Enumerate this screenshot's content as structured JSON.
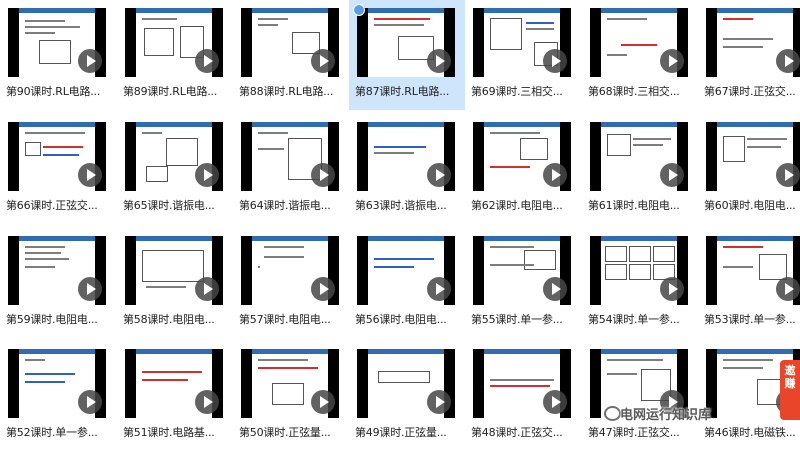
{
  "colors": {
    "thumb_bg": "#000000",
    "selected_bg": "#cfe5fb",
    "slide_header": "#2e6db0",
    "badge": "#e8452b"
  },
  "tiles": [
    {
      "caption": "第90课时.RL电路..."
    },
    {
      "caption": "第89课时.RL电路..."
    },
    {
      "caption": "第88课时.RL电路..."
    },
    {
      "caption": "第87课时.RL电路...",
      "selected": true
    },
    {
      "caption": "第69课时.三相交..."
    },
    {
      "caption": "第68课时.三相交..."
    },
    {
      "caption": "第67课时.正弦交..."
    },
    {
      "caption": "第66课时.正弦交..."
    },
    {
      "caption": "第65课时.谐振电..."
    },
    {
      "caption": "第64课时.谐振电..."
    },
    {
      "caption": "第63课时.谐振电..."
    },
    {
      "caption": "第62课时.电阻电..."
    },
    {
      "caption": "第61课时.电阻电..."
    },
    {
      "caption": "第60课时.电阻电..."
    },
    {
      "caption": "第59课时.电阻电..."
    },
    {
      "caption": "第58课时.电阻电..."
    },
    {
      "caption": "第57课时.电阻电..."
    },
    {
      "caption": "第56课时.电阻电..."
    },
    {
      "caption": "第55课时.单一参..."
    },
    {
      "caption": "第54课时.单一参..."
    },
    {
      "caption": "第53课时.单一参..."
    },
    {
      "caption": "第52课时.单一参..."
    },
    {
      "caption": "第51课时.电路基..."
    },
    {
      "caption": "第50课时.正弦量..."
    },
    {
      "caption": "第49课时.正弦量..."
    },
    {
      "caption": "第48课时.正弦交..."
    },
    {
      "caption": "第47课时.正弦交..."
    },
    {
      "caption": "第46课时.电磁铁..."
    }
  ],
  "watermark": {
    "text": "电网运行知识库",
    "icon": "wechat-icon"
  },
  "side_badge": {
    "text": "邀赚"
  },
  "play_icon": "play-icon"
}
